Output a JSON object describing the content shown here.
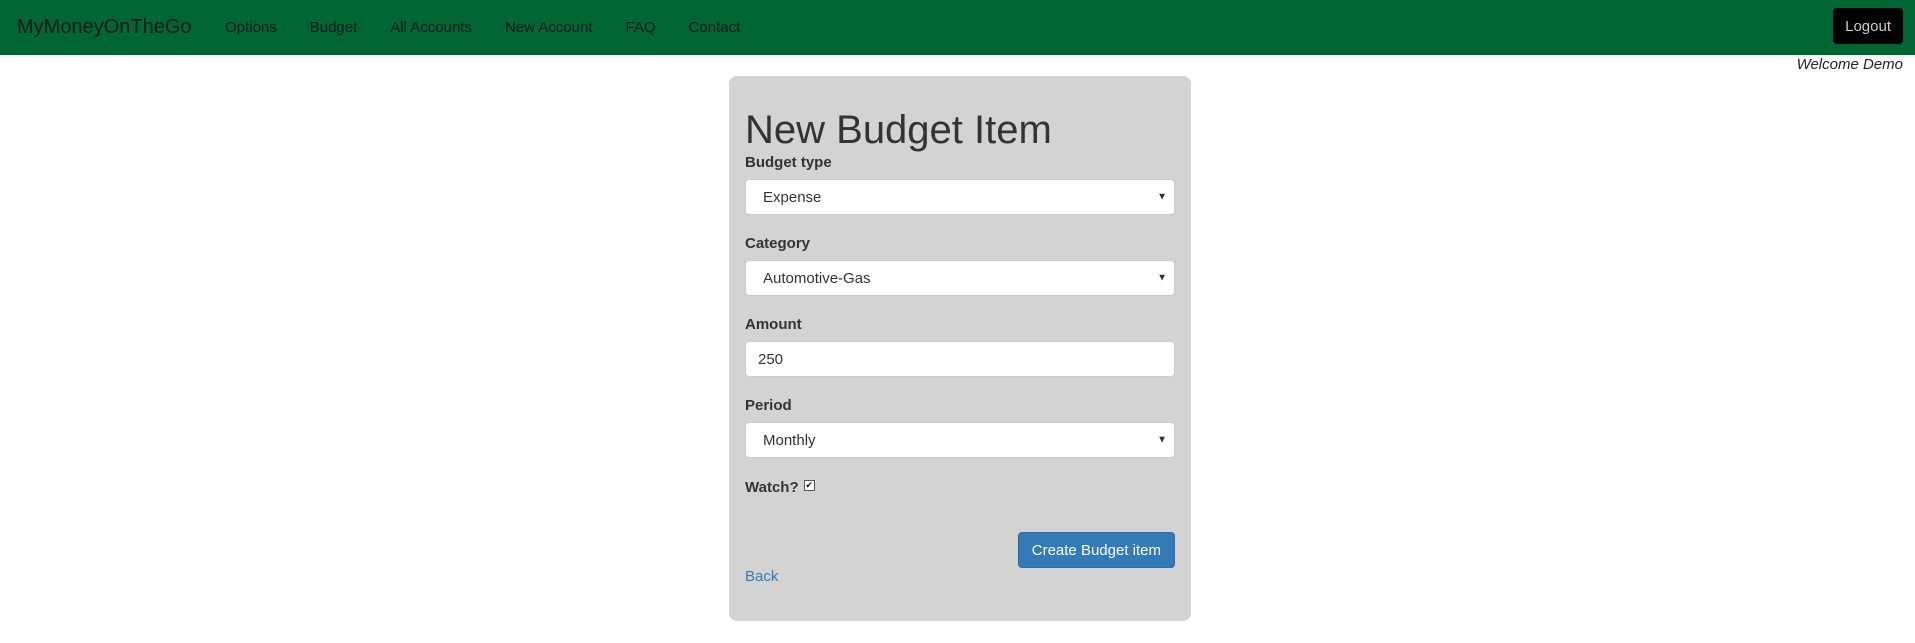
{
  "navbar": {
    "brand": "MyMoneyOnTheGo",
    "links": [
      "Options",
      "Budget",
      "All Accounts",
      "New Account",
      "FAQ",
      "Contact"
    ],
    "logout_label": "Logout",
    "background": "#006633"
  },
  "welcome": "Welcome Demo",
  "form": {
    "title": "New Budget Item",
    "budget_type": {
      "label": "Budget type",
      "value": "Expense"
    },
    "category": {
      "label": "Category",
      "value": "Automotive-Gas"
    },
    "amount": {
      "label": "Amount",
      "value": "250"
    },
    "period": {
      "label": "Period",
      "value": "Monthly"
    },
    "watch": {
      "label": "Watch?",
      "checked": true
    },
    "create_label": "Create Budget item",
    "back_label": "Back"
  },
  "colors": {
    "primary_button": "#337ab7",
    "card_background": "#d3d3d3"
  },
  "icons": {
    "select_caret": "caret-down-icon",
    "checkbox_mark": "checkmark-icon"
  }
}
